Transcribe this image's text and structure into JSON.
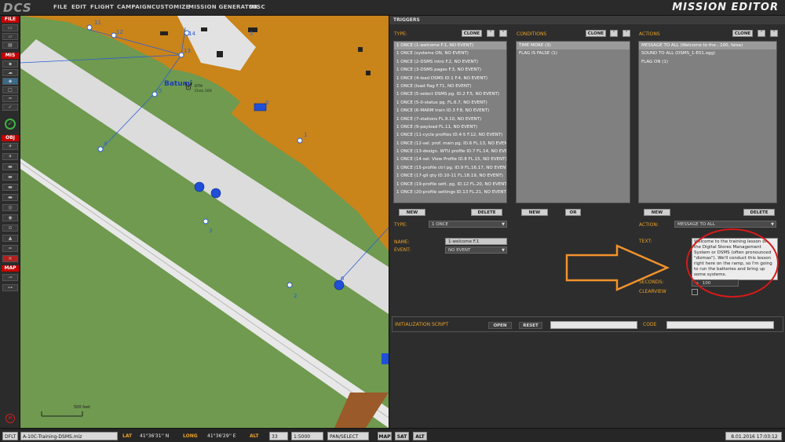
{
  "app": {
    "logo": "DCS",
    "title": "MISSION EDITOR"
  },
  "menu": [
    "FILE",
    "EDIT",
    "FLIGHT",
    "CAMPAIGN",
    "CUSTOMIZE",
    "MISSION GENERATOR",
    "MISC"
  ],
  "toolbar": {
    "sections": [
      "FILE",
      "MIS",
      "OBJ",
      "MAP"
    ]
  },
  "map": {
    "airfield_name": "Batumi",
    "airfield_info": "BTM\nChan 16X",
    "scale_label": "500 feet",
    "waypoints": [
      "11",
      "12",
      "13",
      "14",
      "0",
      "1",
      "2",
      "3",
      "4",
      "5",
      "6",
      "5"
    ]
  },
  "triggers": {
    "panel_title": "TRIGGERS",
    "type_label": "TYPE:",
    "conditions_label": "CONDITIONS",
    "actions_label": "ACTIONS",
    "clone_label": "CLONE",
    "up_label": "˄",
    "down_label": "˅",
    "trigger_list": [
      "1 ONCE (1-welcome F.1, NO EVENT)",
      "1 ONCE (systems ON, NO EVENT)",
      "1 ONCE (2-DSMS intro F.2, NO EVENT)",
      "1 ONCE (3-DSMS pages F.3, NO EVENT)",
      "1 ONCE (4-load DSMS ID.1 F.4, NO EVENT)",
      "1 ONCE (load flag F.71, NO EVENT)",
      "1 ONCE (5-select DSMS pg. ID.2 F.5, NO EVENT)",
      "1 ONCE (5-0-status pg. FL.6.7, NO EVENT)",
      "1 ONCE (6-MARM train ID.3 F.8, NO EVENT)",
      "1 ONCE (7-stations FL.9.10, NO EVENT)",
      "1 ONCE (9-payload FL.11, NO EVENT)",
      "1 ONCE (11-cycle profiles ID.4-5 F.12, NO EVENT)",
      "1 ONCE (12-sel. prof. main pg. ID.6 FL.13, NO EVENT)",
      "1 ONCE (13-design. WTU profile ID.7 FL.14, NO EVENT)",
      "1 ONCE (14-sel. View Profile ID.8 FL.15, NO EVENT)",
      "1 ONCE (15-profile ctrl pg. ID.9 FL.16.17, NO EVENT)",
      "1 ONCE (17-gil qty ID.10-11 FL.18.19, NO EVENT)",
      "1 ONCE (19-profile sett. pg. ID.12 FL.20, NO EVENT)",
      "1 ONCE (20-profile settings ID.13 FL.21, NO EVENT)"
    ],
    "conditions_list": [
      "TIME MORE (3)",
      "FLAG IS FALSE (1)"
    ],
    "actions_list": [
      "MESSAGE TO ALL (Welcome to the , 100, false)",
      "SOUND TO ALL (DSMS_1-E01.ogg)",
      "FLAG ON (1)"
    ],
    "new_label": "NEW",
    "delete_label": "DELETE",
    "or_label": "OR",
    "type_field_label": "TYPE:",
    "type_value": "1 ONCE",
    "name_label": "NAME:",
    "name_value": "1-welcome F.1",
    "event_label": "EVENT:",
    "event_value": "NO EVENT",
    "action_label": "ACTION:",
    "action_value": "MESSAGE TO ALL",
    "text_label": "TEXT:",
    "text_value": "Welcome to the training lesson on the Digital Stores Management System or DSMS (often pronounced \"dizmas\"). We'll conduct this lesson right here on the ramp, so I'm going to run the batteries and bring up some systems.",
    "seconds_label": "SECONDS:",
    "seconds_value": "100",
    "clearview_label": "CLEARVIEW",
    "init_script_label": "INITIALIZATION SCRIPT",
    "open_label": "OPEN",
    "reset_label": "RESET",
    "code_label": "CODE"
  },
  "statusbar": {
    "profile": "DFLT",
    "mission_file": "A-10C-Training-DSMS.miz",
    "lat_label": "LAT",
    "lat_value": "41°36'31'' N",
    "long_label": "LONG",
    "long_value": "41°36'29'' E",
    "alt_label": "ALT",
    "alt_value": "33",
    "scale_value": "1:5000",
    "mode_value": "PAN/SELECT",
    "map_btn": "MAP",
    "sat_btn": "SAT",
    "alt_btn": "ALT",
    "datetime": "8.01.2016 17:03:12"
  },
  "colors": {
    "accent": "#e9a227",
    "map_grass": "#6f9a4f",
    "map_soil": "#c9841a",
    "map_tarmac": "#dcdcdc",
    "blue_unit": "#1f4fd6",
    "annotation_red": "#d51a1a",
    "annotation_orange": "#f2922c"
  }
}
